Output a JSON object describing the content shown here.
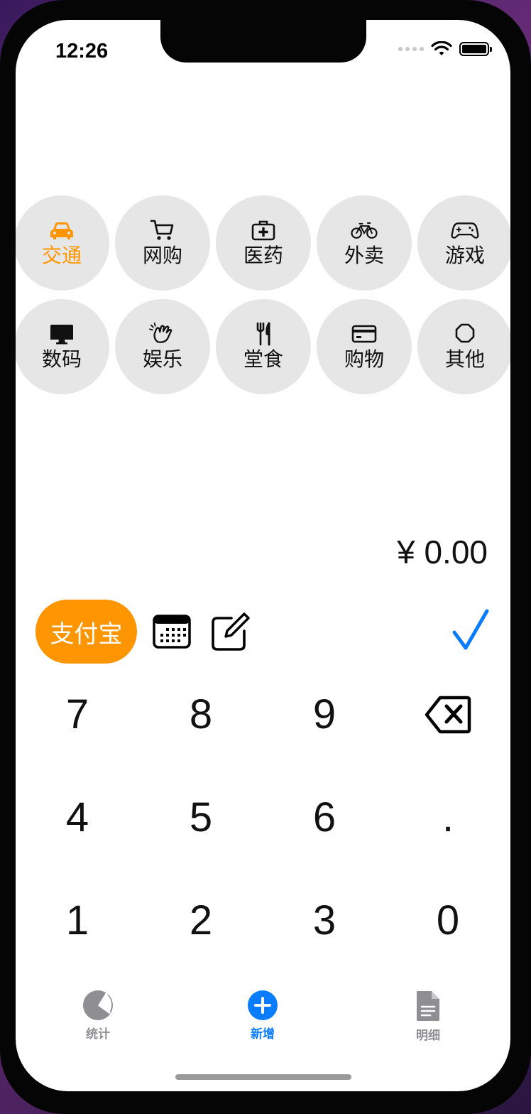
{
  "status": {
    "time": "12:26"
  },
  "categories": [
    {
      "label": "交通",
      "icon": "car-icon",
      "selected": true
    },
    {
      "label": "网购",
      "icon": "cart-icon"
    },
    {
      "label": "医药",
      "icon": "medical-bag-icon"
    },
    {
      "label": "外卖",
      "icon": "bicycle-icon"
    },
    {
      "label": "游戏",
      "icon": "gamecontroller-icon"
    },
    {
      "label": "数码",
      "icon": "desktop-icon"
    },
    {
      "label": "娱乐",
      "icon": "clapping-hands-icon"
    },
    {
      "label": "堂食",
      "icon": "fork-knife-icon"
    },
    {
      "label": "购物",
      "icon": "credit-card-icon"
    },
    {
      "label": "其他",
      "icon": "octagon-icon"
    }
  ],
  "amount": {
    "display": "¥ 0.00"
  },
  "toolbar": {
    "payment_method": "支付宝"
  },
  "keypad": {
    "keys": [
      "7",
      "8",
      "9",
      "⌫",
      "4",
      "5",
      "6",
      ".",
      "1",
      "2",
      "3",
      "0"
    ]
  },
  "tabbar": {
    "tabs": [
      {
        "label": "统计",
        "icon": "chart-pie-icon"
      },
      {
        "label": "新增",
        "icon": "plus-circle-icon",
        "active": true
      },
      {
        "label": "明细",
        "icon": "doc-text-icon"
      }
    ]
  },
  "colors": {
    "accent": "#ff9500",
    "tint": "#0a7cff",
    "category_bg": "#e6e6e6"
  }
}
